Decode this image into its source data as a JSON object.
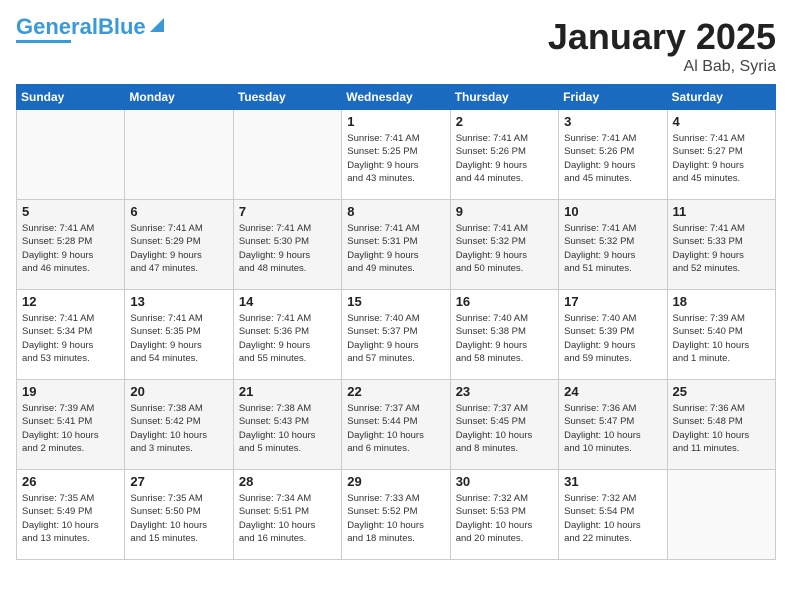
{
  "header": {
    "logo_general": "General",
    "logo_blue": "Blue",
    "month_year": "January 2025",
    "location": "Al Bab, Syria"
  },
  "days_of_week": [
    "Sunday",
    "Monday",
    "Tuesday",
    "Wednesday",
    "Thursday",
    "Friday",
    "Saturday"
  ],
  "weeks": [
    [
      {
        "day": null,
        "content": null
      },
      {
        "day": null,
        "content": null
      },
      {
        "day": null,
        "content": null
      },
      {
        "day": 1,
        "content": "Sunrise: 7:41 AM\nSunset: 5:25 PM\nDaylight: 9 hours\nand 43 minutes."
      },
      {
        "day": 2,
        "content": "Sunrise: 7:41 AM\nSunset: 5:26 PM\nDaylight: 9 hours\nand 44 minutes."
      },
      {
        "day": 3,
        "content": "Sunrise: 7:41 AM\nSunset: 5:26 PM\nDaylight: 9 hours\nand 45 minutes."
      },
      {
        "day": 4,
        "content": "Sunrise: 7:41 AM\nSunset: 5:27 PM\nDaylight: 9 hours\nand 45 minutes."
      }
    ],
    [
      {
        "day": 5,
        "content": "Sunrise: 7:41 AM\nSunset: 5:28 PM\nDaylight: 9 hours\nand 46 minutes."
      },
      {
        "day": 6,
        "content": "Sunrise: 7:41 AM\nSunset: 5:29 PM\nDaylight: 9 hours\nand 47 minutes."
      },
      {
        "day": 7,
        "content": "Sunrise: 7:41 AM\nSunset: 5:30 PM\nDaylight: 9 hours\nand 48 minutes."
      },
      {
        "day": 8,
        "content": "Sunrise: 7:41 AM\nSunset: 5:31 PM\nDaylight: 9 hours\nand 49 minutes."
      },
      {
        "day": 9,
        "content": "Sunrise: 7:41 AM\nSunset: 5:32 PM\nDaylight: 9 hours\nand 50 minutes."
      },
      {
        "day": 10,
        "content": "Sunrise: 7:41 AM\nSunset: 5:32 PM\nDaylight: 9 hours\nand 51 minutes."
      },
      {
        "day": 11,
        "content": "Sunrise: 7:41 AM\nSunset: 5:33 PM\nDaylight: 9 hours\nand 52 minutes."
      }
    ],
    [
      {
        "day": 12,
        "content": "Sunrise: 7:41 AM\nSunset: 5:34 PM\nDaylight: 9 hours\nand 53 minutes."
      },
      {
        "day": 13,
        "content": "Sunrise: 7:41 AM\nSunset: 5:35 PM\nDaylight: 9 hours\nand 54 minutes."
      },
      {
        "day": 14,
        "content": "Sunrise: 7:41 AM\nSunset: 5:36 PM\nDaylight: 9 hours\nand 55 minutes."
      },
      {
        "day": 15,
        "content": "Sunrise: 7:40 AM\nSunset: 5:37 PM\nDaylight: 9 hours\nand 57 minutes."
      },
      {
        "day": 16,
        "content": "Sunrise: 7:40 AM\nSunset: 5:38 PM\nDaylight: 9 hours\nand 58 minutes."
      },
      {
        "day": 17,
        "content": "Sunrise: 7:40 AM\nSunset: 5:39 PM\nDaylight: 9 hours\nand 59 minutes."
      },
      {
        "day": 18,
        "content": "Sunrise: 7:39 AM\nSunset: 5:40 PM\nDaylight: 10 hours\nand 1 minute."
      }
    ],
    [
      {
        "day": 19,
        "content": "Sunrise: 7:39 AM\nSunset: 5:41 PM\nDaylight: 10 hours\nand 2 minutes."
      },
      {
        "day": 20,
        "content": "Sunrise: 7:38 AM\nSunset: 5:42 PM\nDaylight: 10 hours\nand 3 minutes."
      },
      {
        "day": 21,
        "content": "Sunrise: 7:38 AM\nSunset: 5:43 PM\nDaylight: 10 hours\nand 5 minutes."
      },
      {
        "day": 22,
        "content": "Sunrise: 7:37 AM\nSunset: 5:44 PM\nDaylight: 10 hours\nand 6 minutes."
      },
      {
        "day": 23,
        "content": "Sunrise: 7:37 AM\nSunset: 5:45 PM\nDaylight: 10 hours\nand 8 minutes."
      },
      {
        "day": 24,
        "content": "Sunrise: 7:36 AM\nSunset: 5:47 PM\nDaylight: 10 hours\nand 10 minutes."
      },
      {
        "day": 25,
        "content": "Sunrise: 7:36 AM\nSunset: 5:48 PM\nDaylight: 10 hours\nand 11 minutes."
      }
    ],
    [
      {
        "day": 26,
        "content": "Sunrise: 7:35 AM\nSunset: 5:49 PM\nDaylight: 10 hours\nand 13 minutes."
      },
      {
        "day": 27,
        "content": "Sunrise: 7:35 AM\nSunset: 5:50 PM\nDaylight: 10 hours\nand 15 minutes."
      },
      {
        "day": 28,
        "content": "Sunrise: 7:34 AM\nSunset: 5:51 PM\nDaylight: 10 hours\nand 16 minutes."
      },
      {
        "day": 29,
        "content": "Sunrise: 7:33 AM\nSunset: 5:52 PM\nDaylight: 10 hours\nand 18 minutes."
      },
      {
        "day": 30,
        "content": "Sunrise: 7:32 AM\nSunset: 5:53 PM\nDaylight: 10 hours\nand 20 minutes."
      },
      {
        "day": 31,
        "content": "Sunrise: 7:32 AM\nSunset: 5:54 PM\nDaylight: 10 hours\nand 22 minutes."
      },
      {
        "day": null,
        "content": null
      }
    ]
  ]
}
